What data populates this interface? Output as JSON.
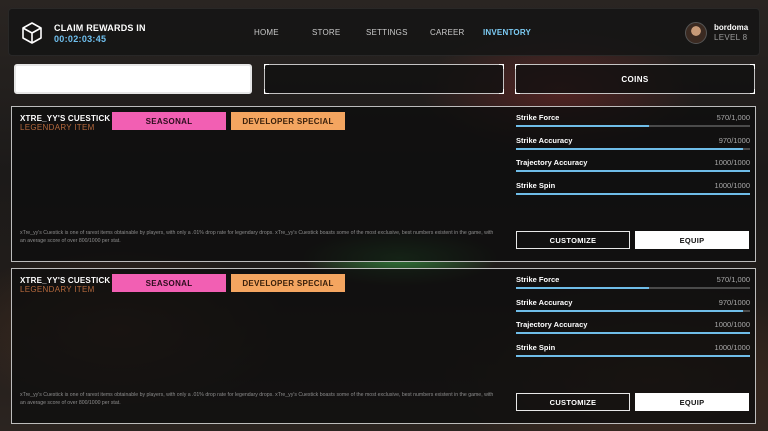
{
  "header": {
    "claim_title": "CLAIM REWARDS IN",
    "claim_timer": "00:02:03:45",
    "nav": [
      {
        "label": "HOME",
        "active": false
      },
      {
        "label": "STORE",
        "active": false
      },
      {
        "label": "SETTINGS",
        "active": false
      },
      {
        "label": "CAREER",
        "active": false
      },
      {
        "label": "INVENTORY",
        "active": true
      }
    ],
    "user": {
      "name": "bordoma",
      "level": "LEVEL 8"
    },
    "icons": {
      "rewards": "cube-icon",
      "avatar": "avatar-image"
    }
  },
  "filters": {
    "box1_label": "",
    "box2_label": "",
    "box3_label": "COINS"
  },
  "colors": {
    "accent": "#6fbde8",
    "rarity": "#b4683c",
    "tag_seasonal": "#f25fb3",
    "tag_developer": "#f4a560"
  },
  "items": [
    {
      "name": "XTRE_YY'S CUESTICK",
      "rarity": "LEGENDARY ITEM",
      "tags": [
        "SEASONAL",
        "DEVELOPER SPECIAL"
      ],
      "description": "xTre_yy's Cuestick is one of rarest items obtainable by players, with only a .01% drop rate for legendary drops. xTre_yy's Cuestick boasts some of the most exclusive, best numbers existent in the game, with an average score of over 800/1000 per stat.",
      "stats": [
        {
          "name": "Strike Force",
          "value": "570/1,000",
          "fraction": 0.57
        },
        {
          "name": "Strike Accuracy",
          "value": "970/1000",
          "fraction": 0.97
        },
        {
          "name": "Trajectory Accuracy",
          "value": "1000/1000",
          "fraction": 1.0
        },
        {
          "name": "Strike Spin",
          "value": "1000/1000",
          "fraction": 1.0
        }
      ],
      "customize_label": "CUSTOMIZE",
      "equip_label": "EQUIP"
    },
    {
      "name": "XTRE_YY'S CUESTICK",
      "rarity": "LEGENDARY ITEM",
      "tags": [
        "SEASONAL",
        "DEVELOPER SPECIAL"
      ],
      "description": "xTre_yy's Cuestick is one of rarest items obtainable by players, with only a .01% drop rate for legendary drops. xTre_yy's Cuestick boasts some of the most exclusive, best numbers existent in the game, with an average score of over 800/1000 per stat.",
      "stats": [
        {
          "name": "Strike Force",
          "value": "570/1,000",
          "fraction": 0.57
        },
        {
          "name": "Strike Accuracy",
          "value": "970/1000",
          "fraction": 0.97
        },
        {
          "name": "Trajectory Accuracy",
          "value": "1000/1000",
          "fraction": 1.0
        },
        {
          "name": "Strike Spin",
          "value": "1000/1000",
          "fraction": 1.0
        }
      ],
      "customize_label": "CUSTOMIZE",
      "equip_label": "EQUIP"
    }
  ]
}
